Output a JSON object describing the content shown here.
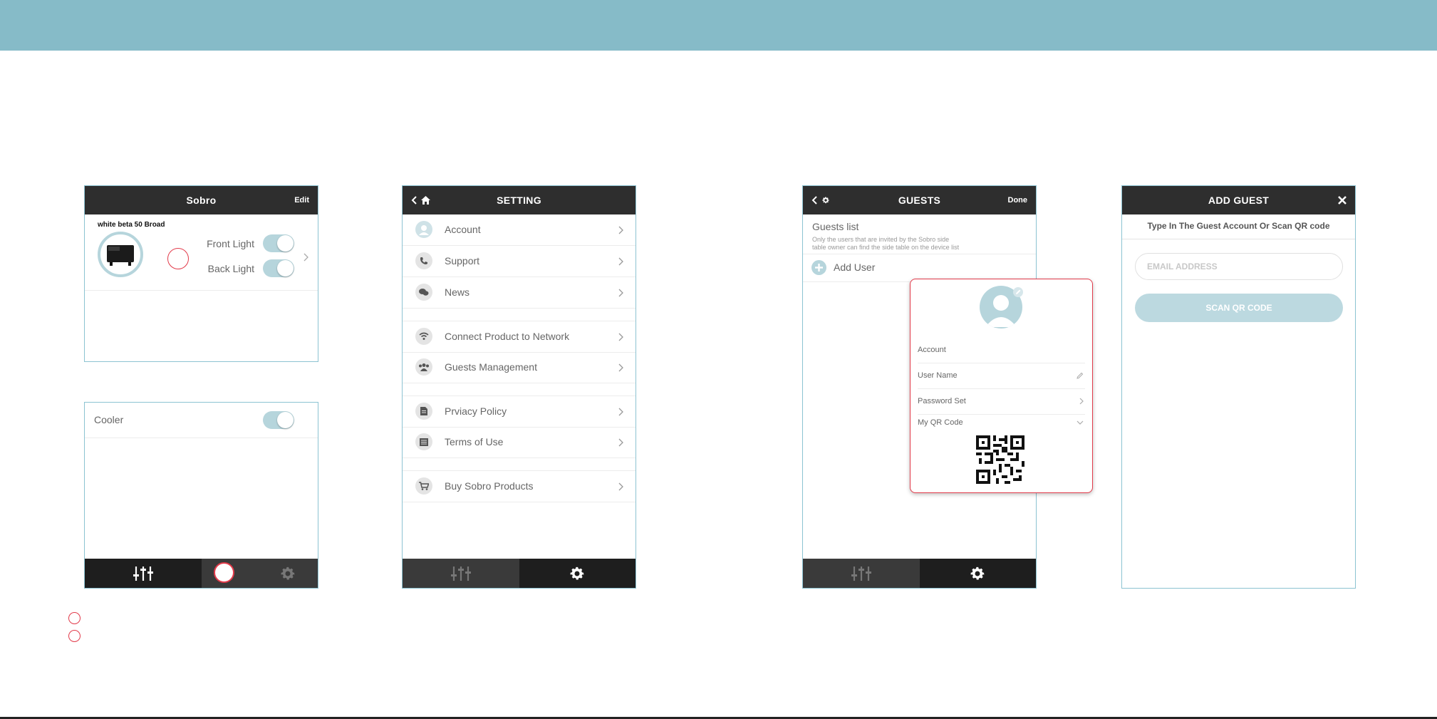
{
  "colors": {
    "topbar": "#86bbc8",
    "header": "#2e2e2e",
    "screen_border": "#8cc3d2",
    "toggle_on": "#b6d5dc",
    "accent_red": "#e23a4a",
    "scan_button": "#bcd9e0"
  },
  "screen1": {
    "title": "Sobro",
    "edit": "Edit",
    "device_name": "white beta 50 Broad",
    "front_light": "Front Light",
    "back_light": "Back Light",
    "front_light_on": true,
    "back_light_on": true
  },
  "screen1b": {
    "cooler": "Cooler",
    "cooler_on": true,
    "tabs": [
      "sliders-icon",
      "gear-icon"
    ]
  },
  "screen2": {
    "title": "SETTING",
    "items": [
      {
        "label": "Account",
        "icon": "user-icon"
      },
      {
        "label": "Support",
        "icon": "phone-icon"
      },
      {
        "label": "News",
        "icon": "chat-icon"
      },
      {
        "label": "Connect Product to Network",
        "icon": "wifi-icon"
      },
      {
        "label": "Guests Management",
        "icon": "users-icon"
      },
      {
        "label": "Prviacy Policy",
        "icon": "document-icon"
      },
      {
        "label": "Terms of Use",
        "icon": "list-icon"
      },
      {
        "label": "Buy Sobro Products",
        "icon": "cart-icon"
      }
    ]
  },
  "screen3": {
    "title": "GUESTS",
    "done": "Done",
    "list_title": "Guests list",
    "list_desc_1": "Only the users that are invited by the Sobro side",
    "list_desc_2": "table owner can find the side table on the device list",
    "add_user": "Add User"
  },
  "popup": {
    "account": "Account",
    "user_name": "User Name",
    "password_set": "Password Set",
    "qr_code": "My QR Code"
  },
  "screen4": {
    "title": "ADD GUEST",
    "instruction": "Type In The Guest Account Or Scan QR code",
    "email_placeholder": "EMAIL ADDRESS",
    "scan_button": "SCAN QR CODE"
  }
}
